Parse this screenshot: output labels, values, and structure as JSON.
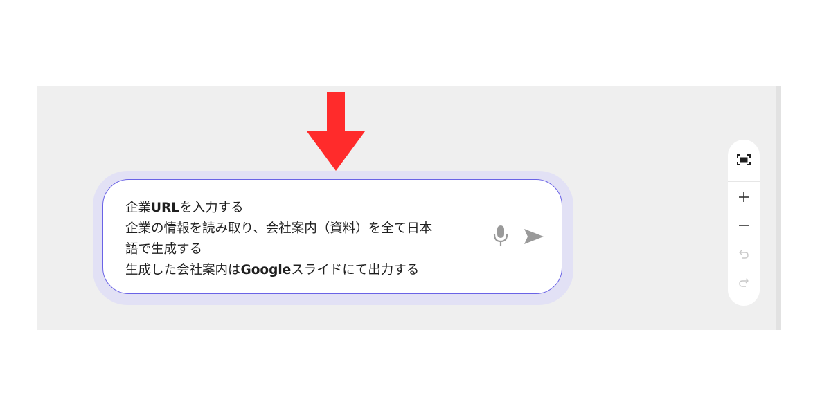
{
  "prompt": {
    "line1_prefix": "企業",
    "line1_bold": "URL",
    "line1_suffix": "を入力する",
    "line2": "企業の情報を読み取り、会社案内（資料）を全て日本",
    "line3": "語で生成する",
    "line4_prefix": "生成した会社案内は",
    "line4_bold": "Google",
    "line4_suffix": "スライドにて出力する"
  },
  "icons": {
    "arrow": "down-arrow-icon",
    "mic": "microphone-icon",
    "send": "send-icon",
    "fit": "fit-screen-icon",
    "zoom_in": "plus-icon",
    "zoom_out": "minus-icon",
    "undo": "undo-icon",
    "redo": "redo-icon"
  },
  "colors": {
    "arrow": "#ff2b2b",
    "prompt_border": "#6a63e6",
    "prompt_halo": "#e2e1f5",
    "canvas_bg": "#efefef",
    "icon_active": "#1f1f1f",
    "icon_muted": "#9a9a9a",
    "icon_disabled": "#c8c8c8"
  },
  "zoom_controls": {
    "undo_enabled": false,
    "redo_enabled": false
  }
}
